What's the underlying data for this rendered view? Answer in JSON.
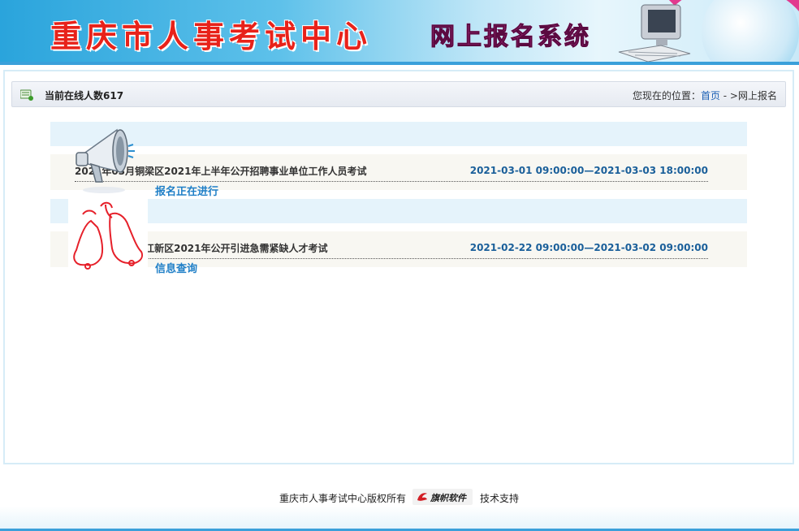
{
  "header": {
    "site_title": "重庆市人事考试中心",
    "system_title": "网上报名系统"
  },
  "status_bar": {
    "online_label": "当前在线人数617",
    "location_prefix": "您现在的位置：",
    "breadcrumb_home": "首页",
    "breadcrumb_sep": " - >",
    "breadcrumb_current": "网上报名"
  },
  "exams": [
    {
      "name": "2021年03月铜梁区2021年上半年公开招聘事业单位工作人员考试",
      "time_range": "2021-03-01 09:00:00—2021-03-03 18:00:00",
      "status": "报名正在进行"
    },
    {
      "name": "2021年02月两江新区2021年公开引进急需紧缺人才考试",
      "time_range": "2021-02-22 09:00:00—2021-03-02 09:00:00",
      "status": "信息查询"
    }
  ],
  "footer": {
    "copyright": "重庆市人事考试中心版权所有",
    "logo_text": "旗帜软件",
    "support": "技术支持"
  },
  "colors": {
    "banner_blue": "#2aa4dc",
    "title_red": "#e8221a",
    "link_blue": "#1f7fc7",
    "time_blue": "#1a5f9a"
  },
  "icons": [
    "users-online-icon",
    "megaphone-icon",
    "bells-icon",
    "computer-icon",
    "qizhi-logo-icon"
  ]
}
